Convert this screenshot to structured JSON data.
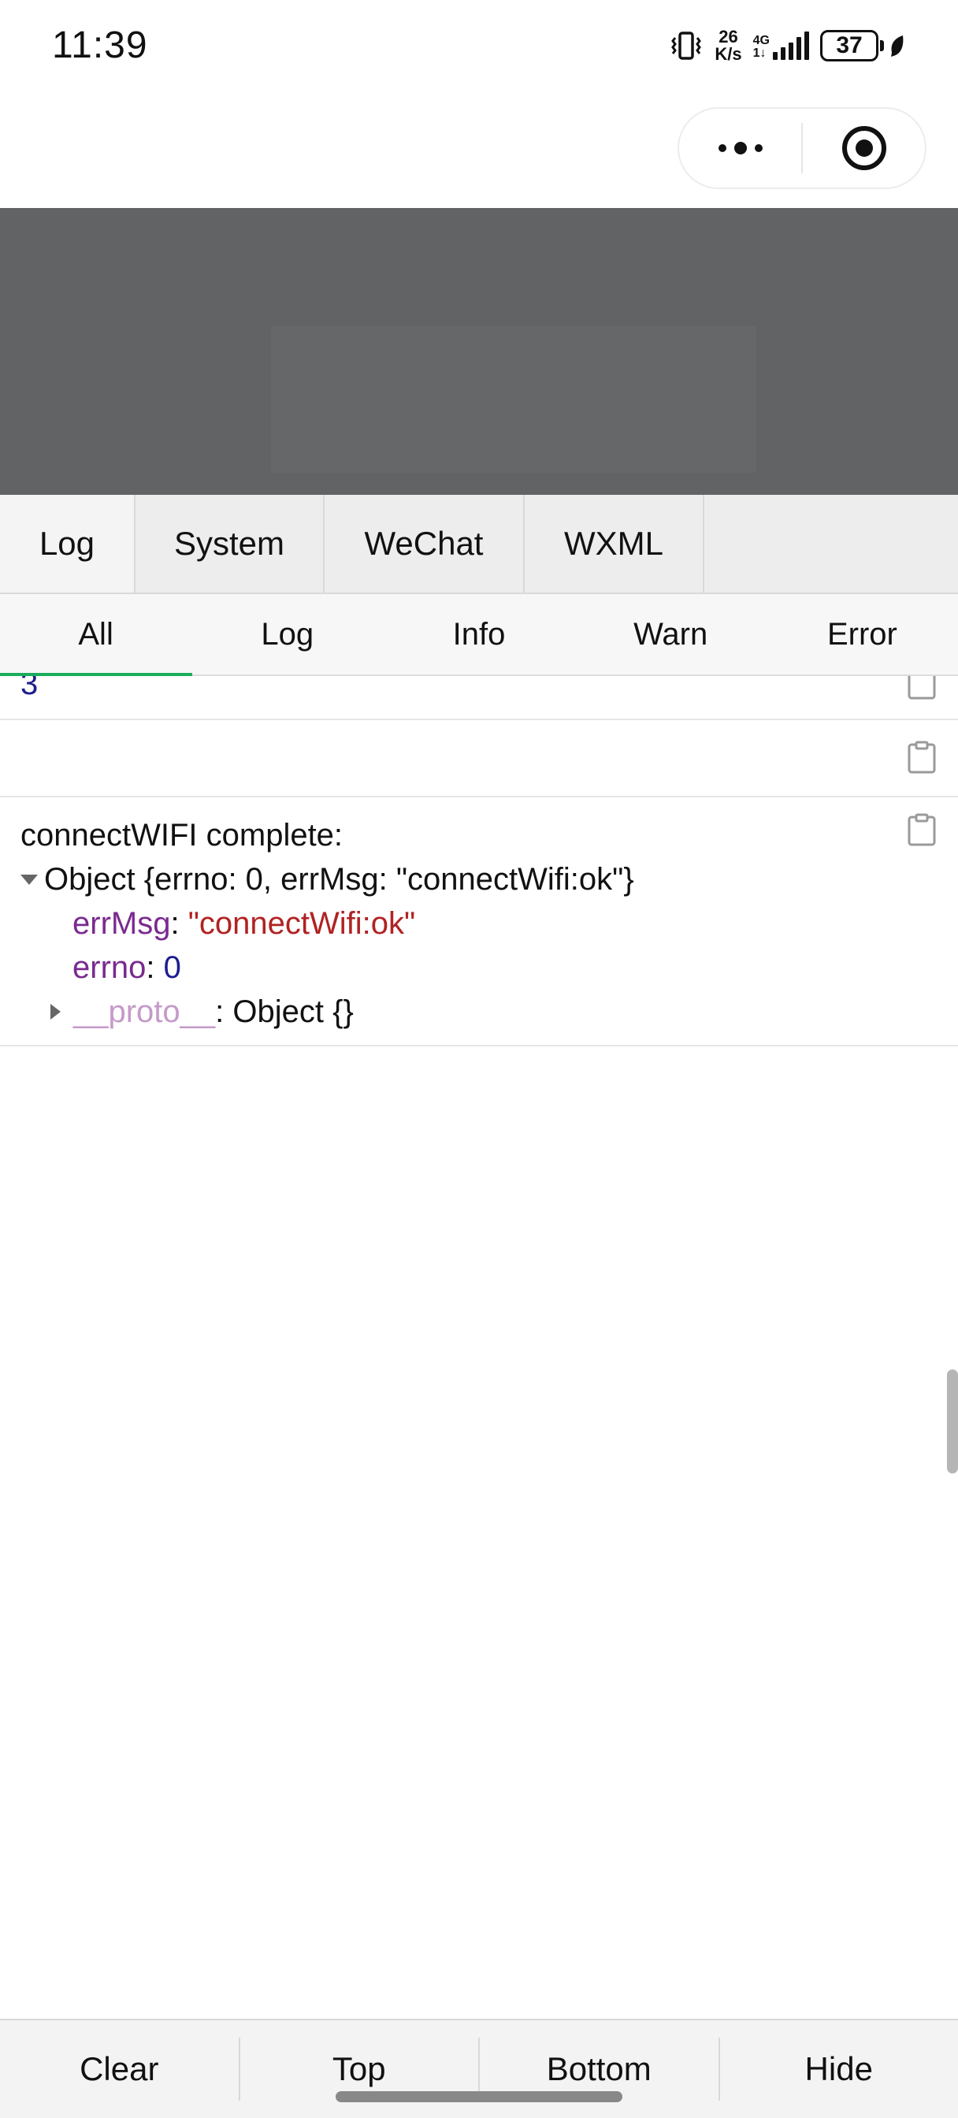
{
  "status_bar": {
    "time": "11:39",
    "speed_value": "26",
    "speed_unit": "K/s",
    "network": "4G",
    "network_sub": "1↓",
    "battery": "37",
    "icons": [
      "vibrate-icon",
      "signal-icon",
      "battery-icon",
      "leaf-icon"
    ]
  },
  "capsule": {
    "icons": [
      "more-dots-icon",
      "close-target-icon"
    ]
  },
  "vconsole": {
    "tabs": [
      "Log",
      "System",
      "WeChat",
      "WXML"
    ],
    "subtabs": [
      "All",
      "Log",
      "Info",
      "Warn",
      "Error"
    ],
    "logs": {
      "row1_value": "3",
      "row3": {
        "title": "connectWIFI complete:",
        "object_summary": "Object {errno: 0, errMsg: \"connectWifi:ok\"}",
        "prop1_key": "errMsg",
        "prop1_value": "\"connectWifi:ok\"",
        "prop2_key": "errno",
        "prop2_value": "0",
        "proto_key": "__proto__",
        "proto_value": ": Object {}",
        "colon": ": "
      }
    },
    "toolbar": [
      "Clear",
      "Top",
      "Bottom",
      "Hide"
    ]
  },
  "colors": {
    "dim_overlay": "#626364",
    "accent": "#1aad5a",
    "key_purple": "#7a2a8f",
    "string_red": "#b12222",
    "number_blue": "#1c1d8f"
  }
}
